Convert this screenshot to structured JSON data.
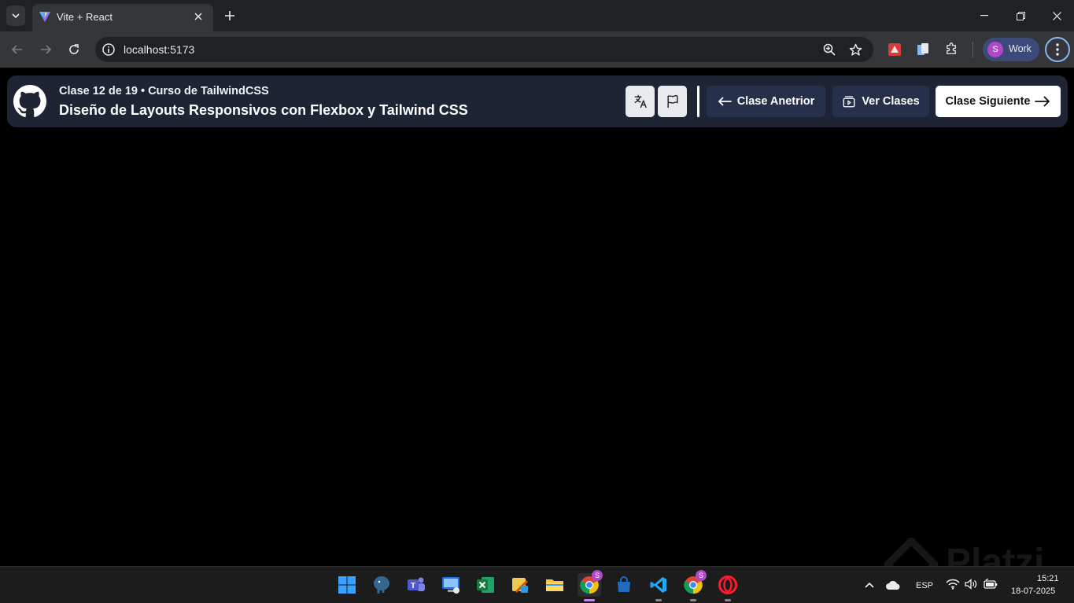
{
  "browser": {
    "tab": {
      "title": "Vite + React"
    },
    "url": "localhost:5173",
    "profile": {
      "initial": "S",
      "label": "Work"
    }
  },
  "header": {
    "subtitle": "Clase 12 de 19 • Curso de TailwindCSS",
    "title": "Diseño de Layouts Responsivos con Flexbox y Tailwind CSS",
    "buttons": {
      "previous": "Clase Anetrior",
      "list": "Ver Clases",
      "next": "Clase Siguiente"
    }
  },
  "watermark": "Platzi",
  "taskbar": {
    "language": "ESP",
    "time": "15:21",
    "date": "18-07-2025",
    "badge": "S"
  },
  "colors": {
    "header_bg": "#1e2433",
    "dark_button": "#26304a",
    "profile_chip": "#3c4a7a",
    "avatar": "#b048c8"
  }
}
